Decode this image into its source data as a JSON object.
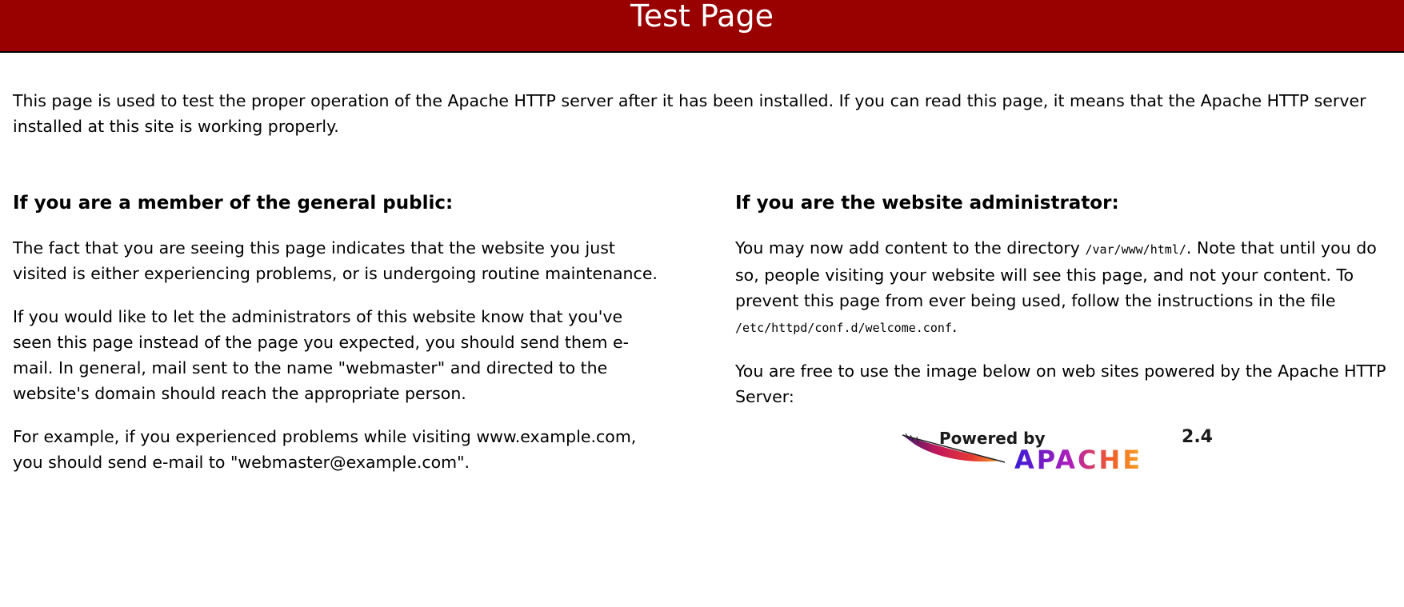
{
  "banner": {
    "title": "Test Page",
    "background": "#990000"
  },
  "intro": "This page is used to test the proper operation of the Apache HTTP server after it has been installed. If you can read this page, it means that the Apache HTTP server installed at this site is working properly.",
  "public_section": {
    "heading": "If you are a member of the general public:",
    "paragraphs": [
      "The fact that you are seeing this page indicates that the website you just visited is either experiencing problems, or is undergoing routine maintenance.",
      "If you would like to let the administrators of this website know that you've seen this page instead of the page you expected, you should send them e-mail. In general, mail sent to the name \"webmaster\" and directed to the website's domain should reach the appropriate person.",
      "For example, if you experienced problems while visiting www.example.com, you should send e-mail to \"webmaster@example.com\"."
    ]
  },
  "admin_section": {
    "heading": "If you are the website administrator:",
    "p1_before": "You may now add content to the directory ",
    "p1_dir": "/var/www/html/",
    "p1_after": ". Note that until you do so, people visiting your website will see this page, and not your content. To prevent this page from ever being used, follow the instructions in the file ",
    "p1_file": "/etc/httpd/conf.d/welcome.conf",
    "p1_end": ".",
    "p2": "You are free to use the image below on web sites powered by the Apache HTTP Server:"
  },
  "powered_badge": {
    "powered_by": "Powered by",
    "version": "2.4",
    "name": "APACHE"
  }
}
